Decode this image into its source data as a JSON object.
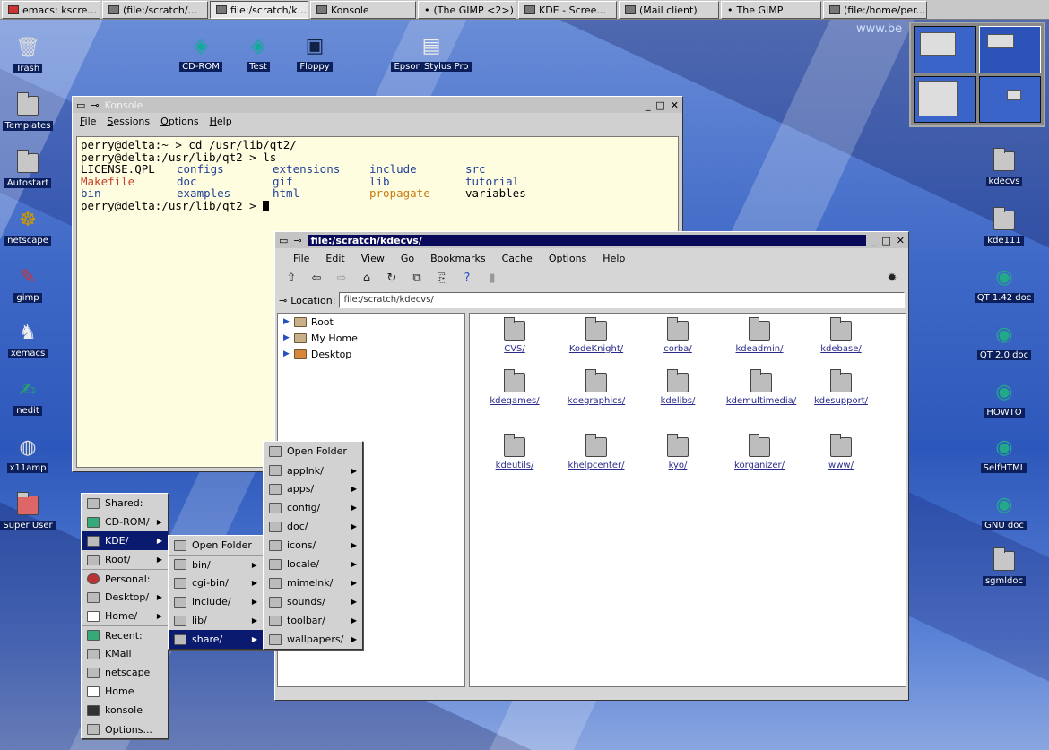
{
  "taskbar": {
    "items": [
      {
        "label": "emacs: kscre...",
        "active": false
      },
      {
        "label": "(file:/scratch/...",
        "active": false
      },
      {
        "label": "file:/scratch/k...",
        "active": true
      },
      {
        "label": "Konsole",
        "active": false
      },
      {
        "label": "(The GIMP <2>)",
        "active": false
      },
      {
        "label": "KDE - Scree...",
        "active": false
      },
      {
        "label": "(Mail client)",
        "active": false
      },
      {
        "label": "The GIMP",
        "active": false
      },
      {
        "label": "(file:/home/per...",
        "active": false
      }
    ]
  },
  "brand": "www.be",
  "desktop": {
    "top_icons": [
      "CD-ROM",
      "Test",
      "Floppy",
      "Epson Stylus Pro"
    ],
    "left_icons": [
      "Trash",
      "Templates",
      "Autostart",
      "netscape",
      "gimp",
      "xemacs",
      "nedit",
      "x11amp",
      "Super User"
    ],
    "right_icons": [
      "kdecvs",
      "kde111",
      "QT 1.42 doc",
      "QT 2.0 doc",
      "HOWTO",
      "SelfHTML",
      "GNU doc",
      "sgmldoc"
    ]
  },
  "konsole": {
    "title": "Konsole",
    "menu": [
      "File",
      "Sessions",
      "Options",
      "Help"
    ],
    "lines": {
      "l1": "perry@delta:~ > cd /usr/lib/qt2/",
      "l2": "perry@delta:/usr/lib/qt2 > ls",
      "l5": "perry@delta:/usr/lib/qt2 > "
    },
    "ls": [
      "LICENSE.QPL",
      "configs",
      "extensions",
      "include",
      "src",
      "Makefile",
      "doc",
      "gif",
      "lib",
      "tutorial",
      "bin",
      "examples",
      "html",
      "propagate",
      "variables"
    ]
  },
  "konqueror": {
    "title": "file:/scratch/kdecvs/",
    "menu": [
      "File",
      "Edit",
      "View",
      "Go",
      "Bookmarks",
      "Cache",
      "Options",
      "Help"
    ],
    "location_label": "Location:",
    "location_value": "file:/scratch/kdecvs/",
    "tree": [
      "Root",
      "My Home",
      "Desktop"
    ],
    "files": [
      "CVS/",
      "KodeKnight/",
      "corba/",
      "kdeadmin/",
      "kdebase/",
      "kdegames/",
      "kdegraphics/",
      "kdelibs/",
      "kdemultimedia/",
      "kdesupport/",
      "kdeutils/",
      "khelpcenter/",
      "kyo/",
      "korganizer/",
      "www/"
    ]
  },
  "kmenu": {
    "items": [
      "Shared:",
      "CD-ROM/",
      "KDE/",
      "Root/",
      "Personal:",
      "Desktop/",
      "Home/",
      "Recent:",
      "KMail",
      "netscape",
      "Home",
      "konsole",
      "Options..."
    ]
  },
  "kde_submenu": {
    "items": [
      "Open Folder",
      "bin/",
      "cgi-bin/",
      "include/",
      "lib/",
      "share/"
    ]
  },
  "share_submenu": {
    "items": [
      "Open Folder",
      "applnk/",
      "apps/",
      "config/",
      "doc/",
      "icons/",
      "locale/",
      "mimelnk/",
      "sounds/",
      "toolbar/",
      "wallpapers/"
    ]
  }
}
